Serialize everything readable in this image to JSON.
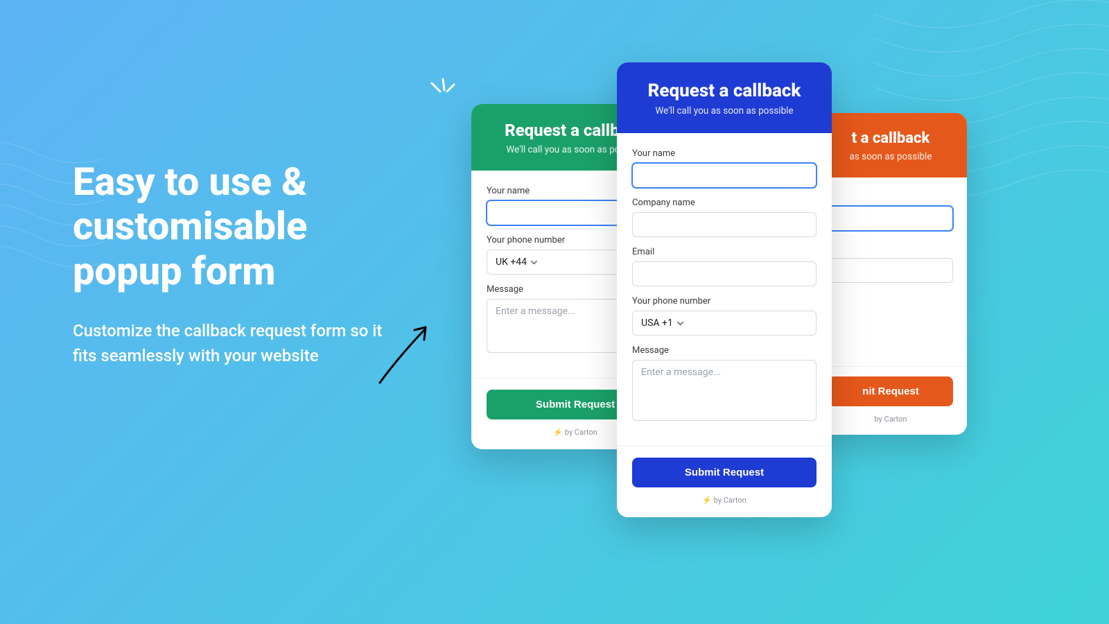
{
  "hero": {
    "headline": "Easy to use & customisable popup form",
    "subhead": "Customize the callback request form so it fits seamlessly with your website"
  },
  "card_common": {
    "title": "Request a callback",
    "subtitle": "We'll call you as soon as possible",
    "submit_label": "Submit Request",
    "byline_prefix": "⚡",
    "byline_text": "by Carton"
  },
  "labels": {
    "your_name": "Your name",
    "company_name": "Company name",
    "email": "Email",
    "your_phone_number": "Your phone number",
    "message": "Message"
  },
  "placeholders": {
    "message": "Enter a message..."
  },
  "green_card": {
    "phone_selected": "UK +44"
  },
  "blue_card": {
    "phone_selected": "USA +1"
  },
  "orange_card": {
    "title_fragment": "t a callback",
    "subtitle_fragment": "as soon as possible",
    "submit_fragment": "nit Request"
  }
}
